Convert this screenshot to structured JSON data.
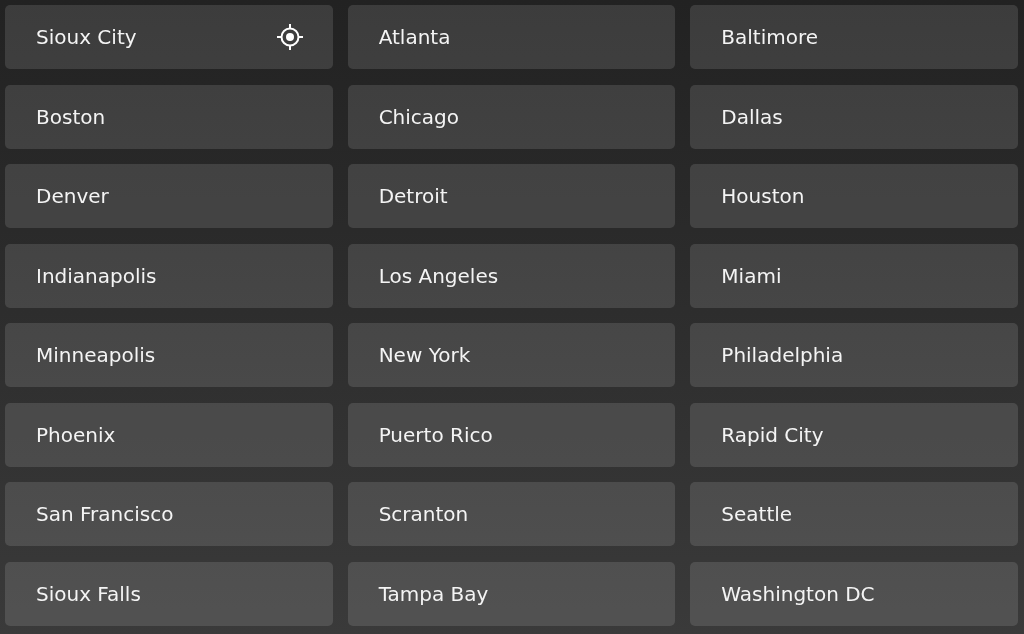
{
  "cities": [
    {
      "name": "Sioux City",
      "current_location": true
    },
    {
      "name": "Atlanta",
      "current_location": false
    },
    {
      "name": "Baltimore",
      "current_location": false
    },
    {
      "name": "Boston",
      "current_location": false
    },
    {
      "name": "Chicago",
      "current_location": false
    },
    {
      "name": "Dallas",
      "current_location": false
    },
    {
      "name": "Denver",
      "current_location": false
    },
    {
      "name": "Detroit",
      "current_location": false
    },
    {
      "name": "Houston",
      "current_location": false
    },
    {
      "name": "Indianapolis",
      "current_location": false
    },
    {
      "name": "Los Angeles",
      "current_location": false
    },
    {
      "name": "Miami",
      "current_location": false
    },
    {
      "name": "Minneapolis",
      "current_location": false
    },
    {
      "name": "New York",
      "current_location": false
    },
    {
      "name": "Philadelphia",
      "current_location": false
    },
    {
      "name": "Phoenix",
      "current_location": false
    },
    {
      "name": "Puerto Rico",
      "current_location": false
    },
    {
      "name": "Rapid City",
      "current_location": false
    },
    {
      "name": "San Francisco",
      "current_location": false
    },
    {
      "name": "Scranton",
      "current_location": false
    },
    {
      "name": "Seattle",
      "current_location": false
    },
    {
      "name": "Sioux Falls",
      "current_location": false
    },
    {
      "name": "Tampa Bay",
      "current_location": false
    },
    {
      "name": "Washington DC",
      "current_location": false
    }
  ]
}
